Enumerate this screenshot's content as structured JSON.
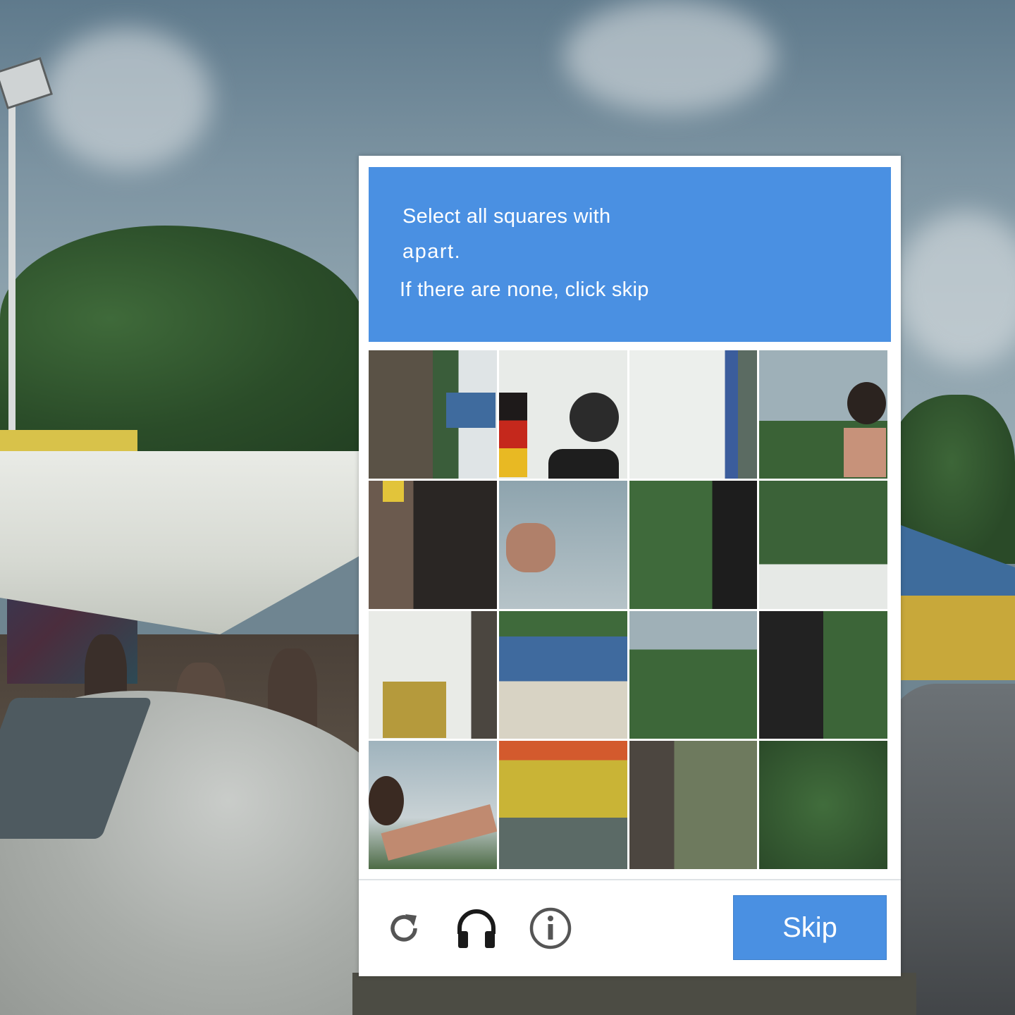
{
  "captcha": {
    "instruction_line1": "Select all squares with",
    "instruction_line2": "apart.",
    "instruction_line3": "If there are none, click skip",
    "skip_label": "Skip",
    "header_color": "#4a90e2",
    "tiles": [
      {
        "name": "tile-1"
      },
      {
        "name": "tile-2"
      },
      {
        "name": "tile-3"
      },
      {
        "name": "tile-4"
      },
      {
        "name": "tile-5"
      },
      {
        "name": "tile-6"
      },
      {
        "name": "tile-7"
      },
      {
        "name": "tile-8"
      },
      {
        "name": "tile-9"
      },
      {
        "name": "tile-10"
      },
      {
        "name": "tile-11"
      },
      {
        "name": "tile-12"
      },
      {
        "name": "tile-13"
      },
      {
        "name": "tile-14"
      },
      {
        "name": "tile-15"
      },
      {
        "name": "tile-16"
      }
    ],
    "footer_icons": [
      "reload-icon",
      "headphones-icon",
      "info-icon"
    ]
  }
}
